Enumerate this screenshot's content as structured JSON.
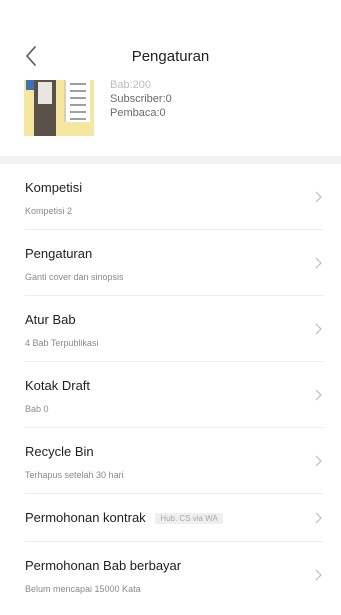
{
  "header": {
    "title": "Pengaturan"
  },
  "book": {
    "stats": {
      "partial_line": "Bab:200",
      "subscriber": "Subscriber:0",
      "reader": "Pembaca:0"
    }
  },
  "menu": {
    "items": [
      {
        "title": "Kompetisi",
        "subtitle": "Kompetisi 2"
      },
      {
        "title": "Pengaturan",
        "subtitle": "Ganti cover dan sinopsis"
      },
      {
        "title": "Atur Bab",
        "subtitle": "4 Bab Terpublikasi"
      },
      {
        "title": "Kotak Draft",
        "subtitle": "Bab 0"
      },
      {
        "title": "Recycle Bin",
        "subtitle": "Terhapus setelah 30 hari"
      },
      {
        "title": "Permohonan kontrak",
        "badge": "Hub. CS via WA"
      },
      {
        "title": "Permohonan Bab berbayar",
        "subtitle": "Belum mencapai 15000 Kata"
      }
    ]
  },
  "icons": {
    "back": "chevron-left-icon",
    "chevron": "chevron-right-icon"
  },
  "colors": {
    "chevron": "#c4c4c4",
    "separator": "#f3f3f3",
    "cover_bg": "#f5e7a0"
  }
}
